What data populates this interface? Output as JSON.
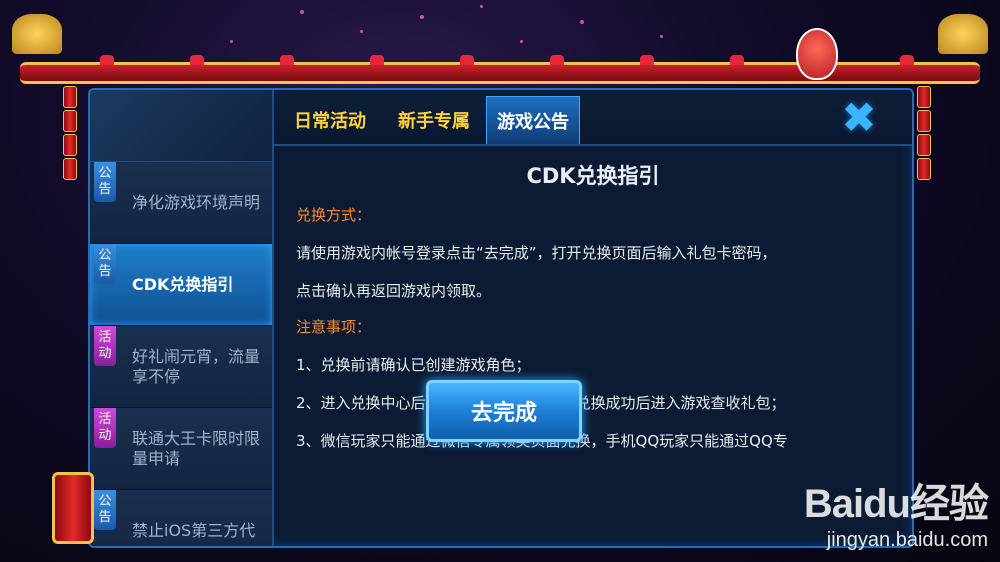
{
  "tabs": [
    {
      "label": "日常活动",
      "active": false
    },
    {
      "label": "新手专属",
      "active": false
    },
    {
      "label": "游戏公告",
      "active": true
    }
  ],
  "sidebar": {
    "items": [
      {
        "tag": "公告",
        "tag_type": "notice",
        "label": "净化游戏环境声明",
        "active": false
      },
      {
        "tag": "公告",
        "tag_type": "notice",
        "label": "CDK兑换指引",
        "active": true
      },
      {
        "tag": "活动",
        "tag_type": "event",
        "label": "好礼闹元宵，流量享不停",
        "active": false
      },
      {
        "tag": "活动",
        "tag_type": "event",
        "label": "联通大王卡限时限量申请",
        "active": false
      },
      {
        "tag": "公告",
        "tag_type": "notice",
        "label": "禁止iOS第三方代",
        "active": false
      }
    ]
  },
  "content": {
    "title": "CDK兑换指引",
    "method_label": "兑换方式：",
    "method_line1": "请使用游戏内帐号登录点击“去完成”，打开兑换页面后输入礼包卡密码，",
    "method_line2": "点击确认再返回游戏内领取。",
    "notes_label": "注意事项：",
    "note1": "1、兑换前请确认已创建游戏角色；",
    "note2": "2、进入兑换中心后，正确填写相关信息，兑换成功后进入游戏查收礼包；",
    "note3": "3、微信玩家只能通过微信专属领奖页面兑换，手机QQ玩家只能通过QQ专"
  },
  "buttons": {
    "done_label": "去完成",
    "close_symbol": "✖"
  },
  "watermark": {
    "logo": "Baidu经验",
    "url": "jingyan.baidu.com"
  },
  "colors": {
    "accent_blue": "#2b6bb1",
    "tab_yellow": "#ffd33a",
    "section_orange": "#ff8a2a",
    "active_item": "#1f7fc9"
  }
}
